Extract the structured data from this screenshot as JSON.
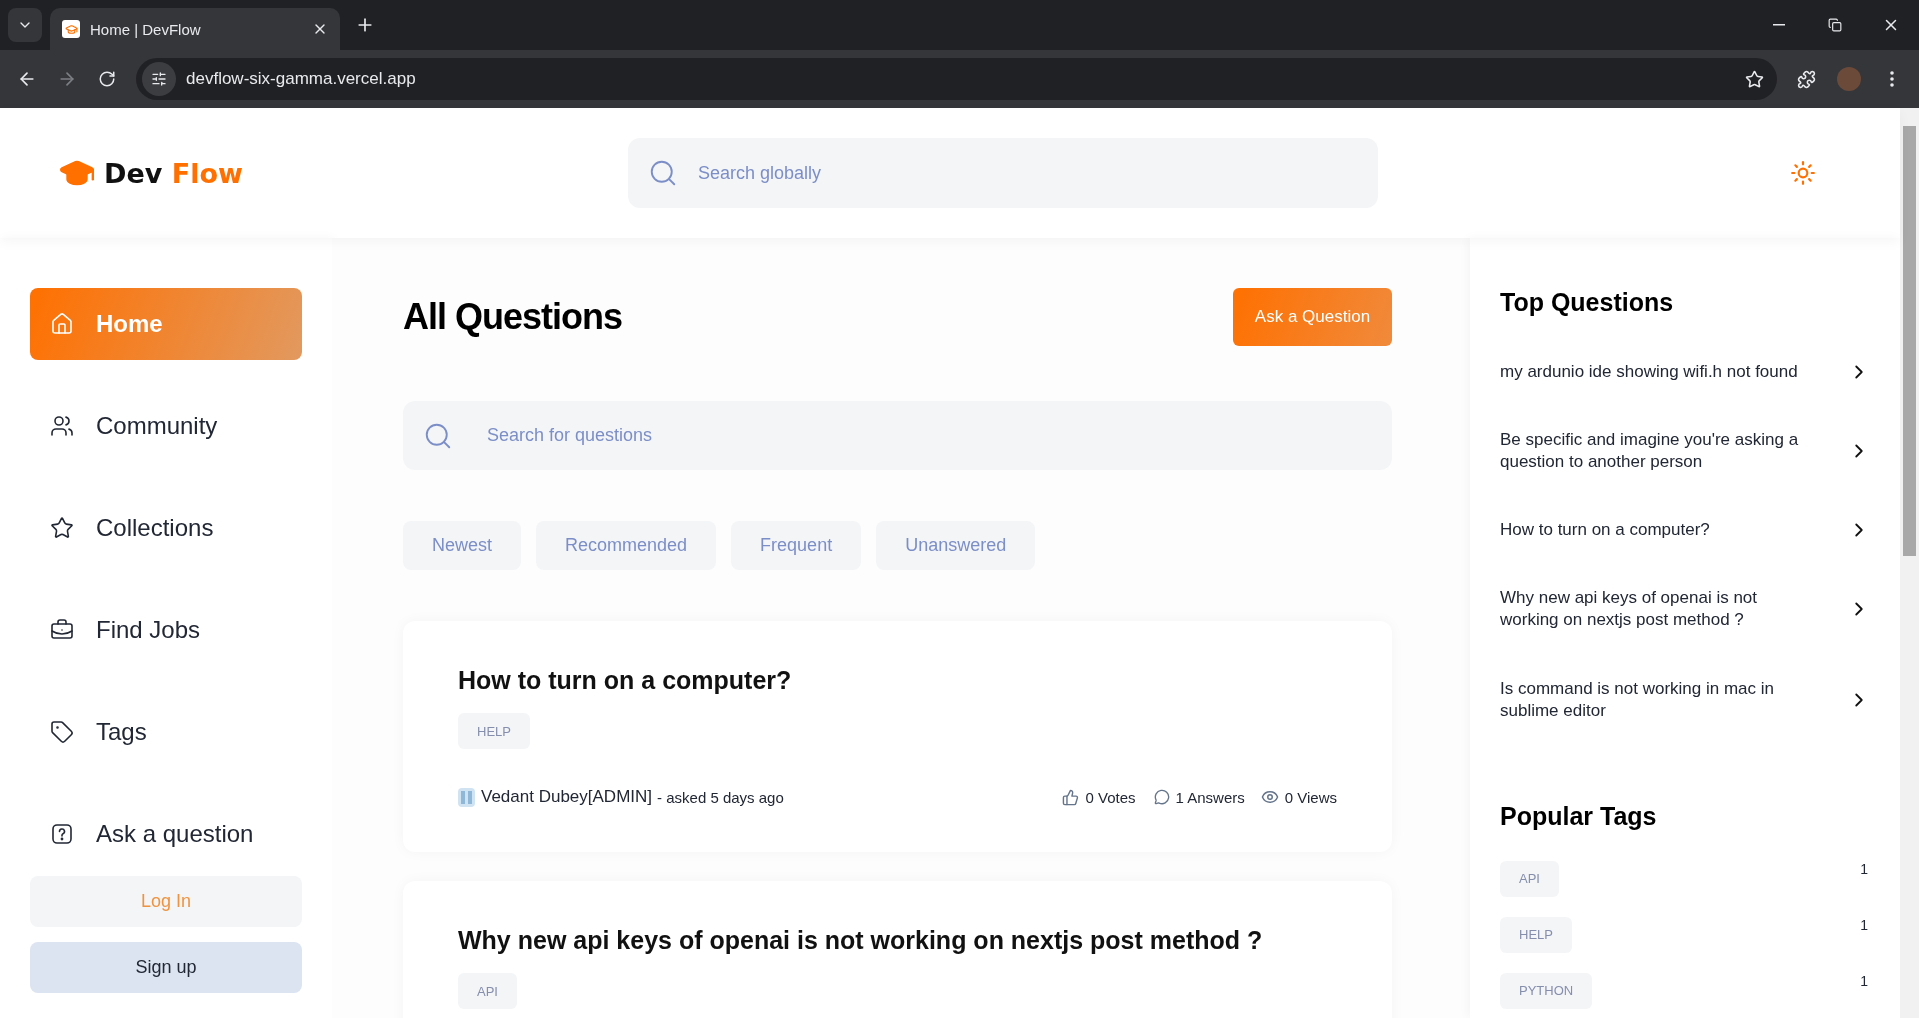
{
  "browser": {
    "tab_title": "Home | DevFlow",
    "url": "devflow-six-gamma.vercel.app"
  },
  "header": {
    "logo_first": "Dev",
    "logo_second": "Flow",
    "search_placeholder": "Search globally"
  },
  "sidebar": {
    "items": [
      {
        "label": "Home",
        "kind": "home",
        "selected": true
      },
      {
        "label": "Community",
        "kind": "community",
        "selected": false
      },
      {
        "label": "Collections",
        "kind": "collections",
        "selected": false
      },
      {
        "label": "Find Jobs",
        "kind": "jobs",
        "selected": false
      },
      {
        "label": "Tags",
        "kind": "tags",
        "selected": false
      },
      {
        "label": "Ask a question",
        "kind": "ask",
        "selected": false
      }
    ],
    "login": "Log In",
    "signup": "Sign up"
  },
  "main": {
    "title": "All Questions",
    "ask_button": "Ask a Question",
    "search_placeholder": "Search for questions",
    "filters": [
      {
        "label": "Newest",
        "selected": false
      },
      {
        "label": "Recommended",
        "selected": false
      },
      {
        "label": "Frequent",
        "selected": false
      },
      {
        "label": "Unanswered",
        "selected": false
      }
    ],
    "questions": [
      {
        "title": "How to turn on a computer?",
        "tags": [
          "HELP"
        ],
        "author": "Vedant Dubey[ADMIN]",
        "asked": "- asked 5 days ago",
        "votes": "0 Votes",
        "answers": "1 Answers",
        "views": "0 Views"
      },
      {
        "title": "Why new api keys of openai is not working on nextjs post method ?",
        "tags": [
          "API"
        ]
      }
    ]
  },
  "right": {
    "top_title": "Top Questions",
    "top_questions": [
      "my ardunio ide showing wifi.h not found",
      "Be specific and imagine you're asking a question to another person",
      "How to turn on a computer?",
      "Why new api keys of openai is not working on nextjs post method ?",
      "Is command is not working in mac in sublime editor"
    ],
    "tags_title": "Popular Tags",
    "tags": [
      {
        "name": "API",
        "count": "1"
      },
      {
        "name": "HELP",
        "count": "1"
      },
      {
        "name": "PYTHON",
        "count": "1"
      }
    ]
  }
}
